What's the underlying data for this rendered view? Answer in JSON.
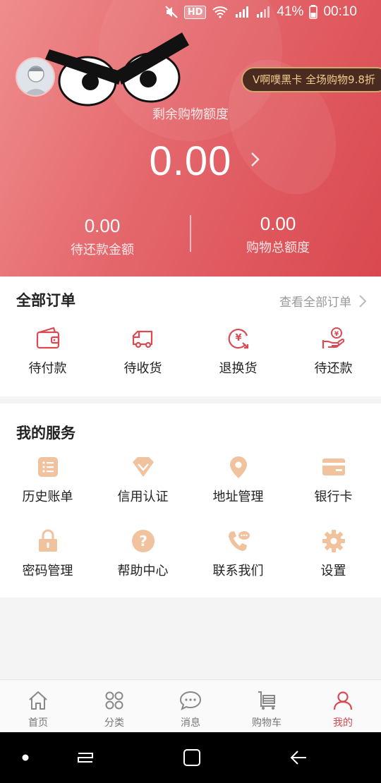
{
  "status_bar": {
    "hd": "HD",
    "net": "4G",
    "net2": "2G",
    "battery": "41%",
    "time": "00:10"
  },
  "header": {
    "vip_text": "V啊噗黑卡 全场购物9.8折",
    "credit_label": "剩余购物额度",
    "credit_value": "0.00",
    "stats": [
      {
        "value": "0.00",
        "label": "待还款金额"
      },
      {
        "value": "0.00",
        "label": "购物总额度"
      }
    ]
  },
  "orders": {
    "title": "全部订单",
    "see_all": "查看全部订单",
    "items": [
      {
        "label": "待付款",
        "icon": "wallet-icon"
      },
      {
        "label": "待收货",
        "icon": "truck-icon"
      },
      {
        "label": "退换货",
        "icon": "refund-icon"
      },
      {
        "label": "待还款",
        "icon": "repay-icon"
      }
    ]
  },
  "services": {
    "title": "我的服务",
    "items": [
      {
        "label": "历史账单",
        "icon": "bill-icon"
      },
      {
        "label": "信用认证",
        "icon": "diamond-icon"
      },
      {
        "label": "地址管理",
        "icon": "location-icon"
      },
      {
        "label": "银行卡",
        "icon": "card-icon"
      },
      {
        "label": "密码管理",
        "icon": "lock-icon"
      },
      {
        "label": "帮助中心",
        "icon": "help-icon"
      },
      {
        "label": "联系我们",
        "icon": "phone-icon"
      },
      {
        "label": "设置",
        "icon": "gear-icon"
      }
    ]
  },
  "tabbar": {
    "items": [
      {
        "label": "首页",
        "icon": "home-icon"
      },
      {
        "label": "分类",
        "icon": "category-icon"
      },
      {
        "label": "消息",
        "icon": "message-icon"
      },
      {
        "label": "购物车",
        "icon": "cart-icon"
      },
      {
        "label": "我的",
        "icon": "profile-icon",
        "active": true
      }
    ]
  },
  "colors": {
    "accent": "#d94a53",
    "service_icon": "#f0c29e",
    "order_icon": "#d94a53"
  }
}
